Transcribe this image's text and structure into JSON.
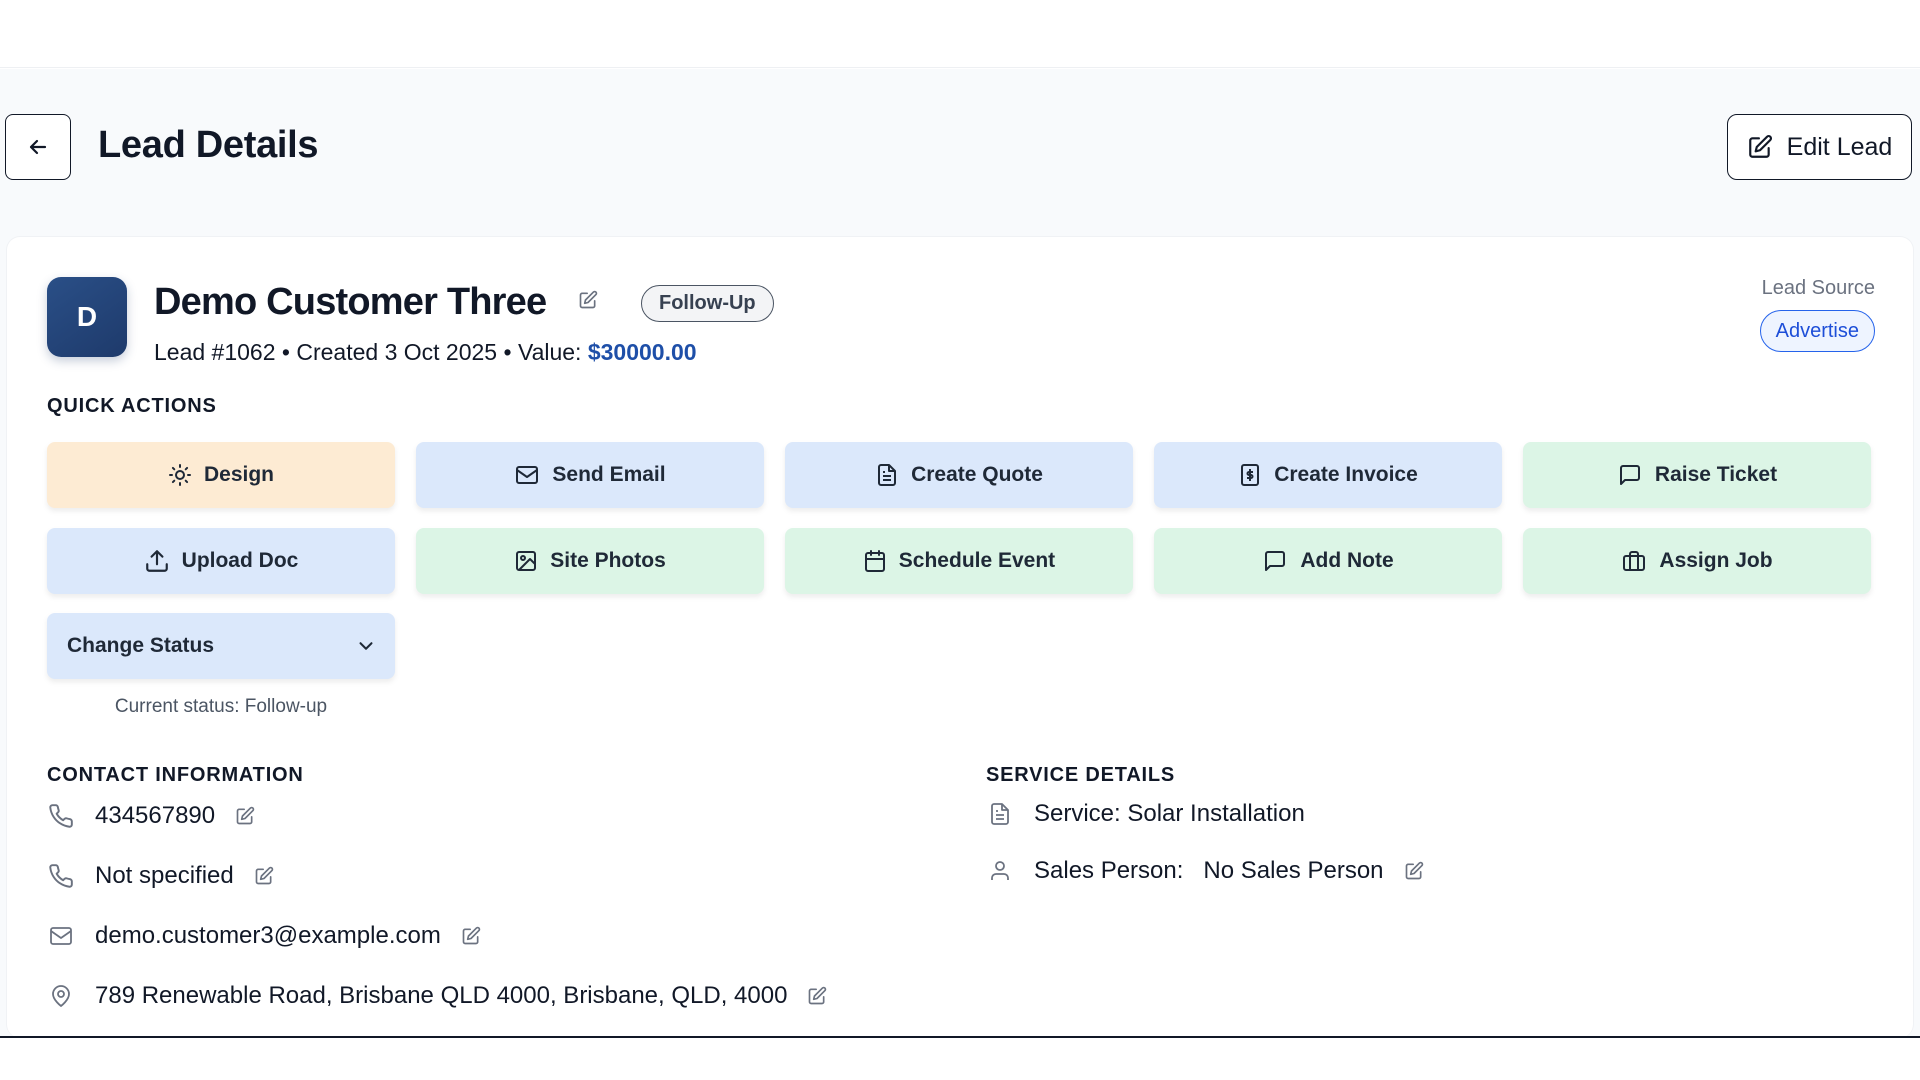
{
  "header": {
    "title": "Lead Details",
    "edit_button_label": "Edit Lead"
  },
  "customer": {
    "avatar_letter": "D",
    "name": "Demo Customer Three",
    "status_badge": "Follow-Up",
    "lead_number": "Lead #1062",
    "created": "Created 3 Oct 2025",
    "value_label": "Value:",
    "value": "$30000.00",
    "separator": "•"
  },
  "lead_source": {
    "label": "Lead Source",
    "value": "Advertise"
  },
  "quick_actions": {
    "title": "QUICK ACTIONS",
    "buttons": [
      {
        "label": "Design",
        "icon": "sun-icon",
        "color": "#fdebd3"
      },
      {
        "label": "Send Email",
        "icon": "mail-icon",
        "color": "#dbe8fb"
      },
      {
        "label": "Create Quote",
        "icon": "file-text-icon",
        "color": "#dbe8fb"
      },
      {
        "label": "Create Invoice",
        "icon": "dollar-file-icon",
        "color": "#dbe8fb"
      },
      {
        "label": "Raise Ticket",
        "icon": "message-square-icon",
        "color": "#dcf5e6"
      },
      {
        "label": "Upload Doc",
        "icon": "upload-icon",
        "color": "#dbe8fb"
      },
      {
        "label": "Site Photos",
        "icon": "image-icon",
        "color": "#dcf5e6"
      },
      {
        "label": "Schedule Event",
        "icon": "calendar-icon",
        "color": "#dcf5e6"
      },
      {
        "label": "Add Note",
        "icon": "message-square-icon",
        "color": "#dcf5e6"
      },
      {
        "label": "Assign Job",
        "icon": "briefcase-icon",
        "color": "#dcf5e6"
      }
    ],
    "change_status_label": "Change Status",
    "current_status": "Current status: Follow-up"
  },
  "contact": {
    "title": "CONTACT INFORMATION",
    "phone": "434567890",
    "alt_phone": "Not specified",
    "email": "demo.customer3@example.com",
    "address": "789 Renewable Road, Brisbane QLD 4000, Brisbane, QLD, 4000"
  },
  "service": {
    "title": "SERVICE DETAILS",
    "service": "Service: Solar Installation",
    "sales_person_label": "Sales Person:",
    "sales_person_value": "No Sales Person"
  },
  "colors": {
    "accent_blue": "#1e4fa8",
    "avatar_bg": "#1e3a6b",
    "lead_source_border": "#2563eb"
  }
}
